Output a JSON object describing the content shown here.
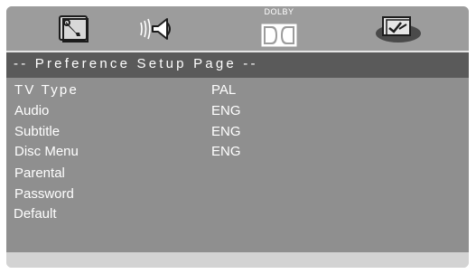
{
  "tabs": [
    {
      "icon": "wrench-settings-icon"
    },
    {
      "icon": "speaker-audio-icon"
    },
    {
      "icon": "dolby-logo-icon",
      "label": "DOLBY"
    },
    {
      "icon": "preference-check-icon"
    }
  ],
  "title": "-- Preference Setup Page --",
  "settings": [
    {
      "label": "TV Type",
      "value": "PAL"
    },
    {
      "label": "Audio",
      "value": "ENG"
    },
    {
      "label": "Subtitle",
      "value": "ENG"
    },
    {
      "label": "Disc Menu",
      "value": "ENG"
    },
    {
      "label": "Parental",
      "value": ""
    },
    {
      "label": "Password",
      "value": ""
    },
    {
      "label": "Default",
      "value": ""
    }
  ],
  "colors": {
    "topbar": "#9c9c9c",
    "titlebar": "#5a5a5a",
    "content": "#8f8f8f",
    "frame": "#d3d3d3",
    "text": "#ffffff"
  }
}
